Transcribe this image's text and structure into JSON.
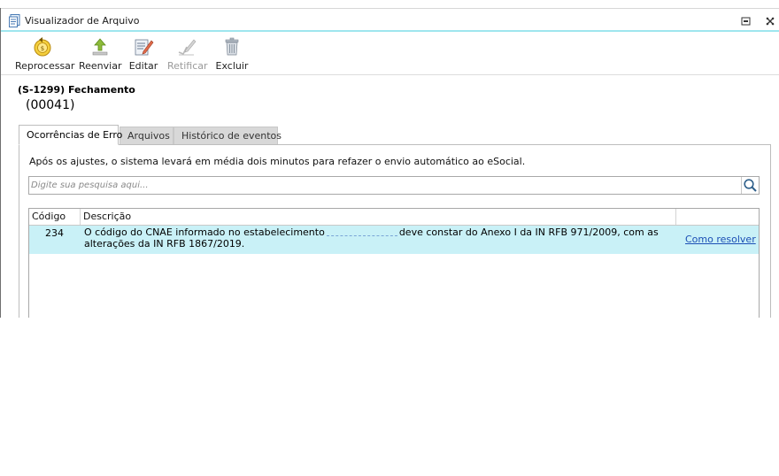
{
  "window": {
    "title": "Visualizador de Arquivo"
  },
  "toolbar": {
    "reprocess_label": "Reprocessar",
    "resend_label": "Reenviar",
    "edit_label": "Editar",
    "rectify_label": "Retificar",
    "delete_label": "Excluir"
  },
  "event": {
    "heading": "(S-1299) Fechamento",
    "subheading": "(00041)"
  },
  "tabs": [
    {
      "label": "Ocorrências de Erro",
      "active": true
    },
    {
      "label": "Arquivos",
      "active": false
    },
    {
      "label": "Histórico de eventos",
      "active": false
    }
  ],
  "panel": {
    "notice": "Após os ajustes, o sistema levará em média dois minutos para refazer o envio automático ao eSocial.",
    "search_placeholder": "Digite sua pesquisa aqui..."
  },
  "grid": {
    "columns": [
      "Código",
      "Descrição"
    ],
    "rows": [
      {
        "code": "234",
        "description_part1": "O código do CNAE informado no estabelecimento",
        "description_part2": "deve constar do Anexo I da IN RFB 971/2009, com as alterações da IN RFB 1867/2019.",
        "action": "Como resolver"
      }
    ]
  },
  "colors": {
    "accent": "#9fe6ee",
    "row_highlight": "#c9f1f7",
    "link": "#1b4fb5"
  }
}
